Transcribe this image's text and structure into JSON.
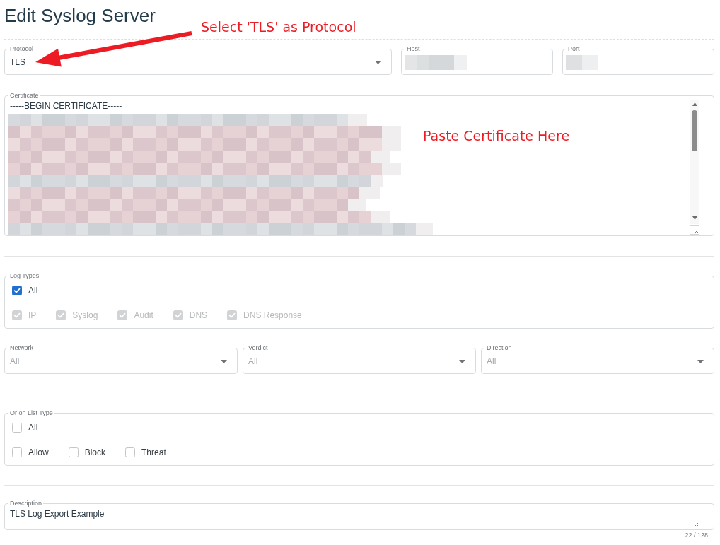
{
  "page": {
    "title": "Edit Syslog Server"
  },
  "annotations": [
    {
      "text": "Select 'TLS' as Protocol",
      "arrow": true
    },
    {
      "text": "Paste Certificate Here",
      "arrow": false
    }
  ],
  "connection": {
    "protocol": {
      "label": "Protocol",
      "value": "TLS"
    },
    "host": {
      "label": "Host",
      "redacted": true
    },
    "port": {
      "label": "Port",
      "redacted": true
    }
  },
  "certificate": {
    "label": "Certificate",
    "value": "-----BEGIN CERTIFICATE-----",
    "redacted": true
  },
  "log_types": {
    "label": "Log Types",
    "all": {
      "label": "All",
      "checked": true,
      "disabled": false
    },
    "options": [
      {
        "label": "IP",
        "checked": true,
        "disabled": true
      },
      {
        "label": "Syslog",
        "checked": true,
        "disabled": true
      },
      {
        "label": "Audit",
        "checked": true,
        "disabled": true
      },
      {
        "label": "DNS",
        "checked": true,
        "disabled": true
      },
      {
        "label": "DNS Response",
        "checked": true,
        "disabled": true
      }
    ]
  },
  "filters": [
    {
      "label": "Network",
      "placeholder": "All"
    },
    {
      "label": "Verdict",
      "placeholder": "All"
    },
    {
      "label": "Direction",
      "placeholder": "All"
    }
  ],
  "list_types": {
    "label": "Or on List Type",
    "all": {
      "label": "All",
      "checked": false,
      "disabled": false
    },
    "options": [
      {
        "label": "Allow",
        "checked": false,
        "disabled": false
      },
      {
        "label": "Block",
        "checked": false,
        "disabled": false
      },
      {
        "label": "Threat",
        "checked": false,
        "disabled": false
      }
    ]
  },
  "description": {
    "label": "Description",
    "value": "TLS Log Export Example",
    "counter": "22 / 128"
  }
}
